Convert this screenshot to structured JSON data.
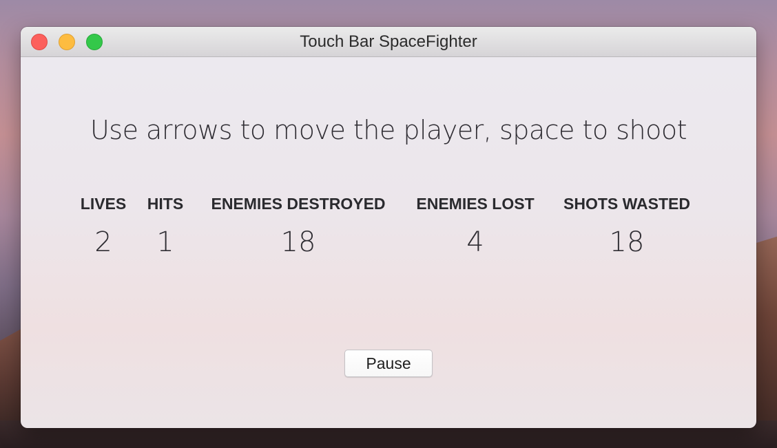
{
  "window": {
    "title": "Touch Bar SpaceFighter"
  },
  "game": {
    "instructions": "Use arrows to move the player, space to shoot",
    "stats": {
      "lives": {
        "label": "LIVES",
        "value": "2"
      },
      "hits": {
        "label": "HITS",
        "value": "1"
      },
      "enemies_destroyed": {
        "label": "ENEMIES DESTROYED",
        "value": "18"
      },
      "enemies_lost": {
        "label": "ENEMIES LOST",
        "value": "4"
      },
      "shots_wasted": {
        "label": "SHOTS WASTED",
        "value": "18"
      }
    },
    "pause_label": "Pause"
  },
  "colors": {
    "close": "#fc605c",
    "minimize": "#fdbc40",
    "zoom": "#34c84a"
  }
}
